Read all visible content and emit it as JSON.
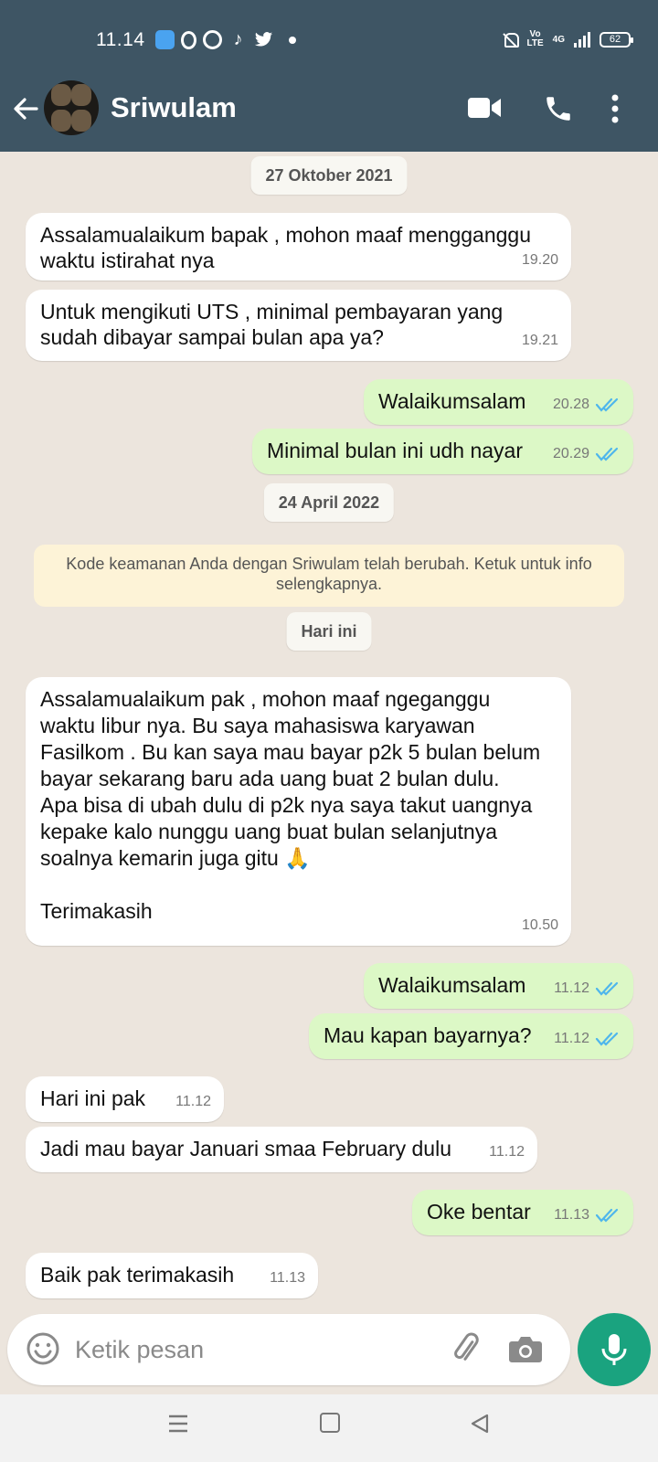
{
  "status_bar": {
    "time": "11.14",
    "battery": "62",
    "network": "4G",
    "volte_top": "Vo",
    "volte_bottom": "LTE"
  },
  "header": {
    "contact_name": "Sriwulam",
    "color": "#3E5564"
  },
  "chat": {
    "dates": [
      "27 Oktober 2021",
      "24 April 2022",
      "Hari ini"
    ],
    "security_notice": "Kode keamanan Anda dengan Sriwulam telah berubah. Ketuk untuk info selengkapnya.",
    "messages": [
      {
        "dir": "in",
        "text": "Assalamualaikum bapak , mohon maaf mengganggu\nwaktu istirahat nya",
        "time": "19.20"
      },
      {
        "dir": "in",
        "text": "Untuk mengikuti UTS , minimal pembayaran yang\nsudah dibayar sampai bulan apa ya?",
        "time": "19.21"
      },
      {
        "dir": "out",
        "text": "Walaikumsalam",
        "time": "20.28"
      },
      {
        "dir": "out",
        "text": "Minimal bulan ini udh nayar",
        "time": "20.29"
      },
      {
        "dir": "in",
        "text": "Assalamualaikum pak , mohon maaf ngeganggu\nwaktu libur nya. Bu saya mahasiswa karyawan\nFasilkom . Bu kan saya mau bayar p2k 5 bulan belum\nbayar sekarang baru ada uang buat 2 bulan dulu.\nApa bisa di ubah dulu di p2k nya saya takut uangnya\nkepake kalo nunggu uang buat bulan selanjutnya\nsoalnya kemarin juga gitu 🙏\n\nTerimakasih",
        "time": "10.50"
      },
      {
        "dir": "out",
        "text": "Walaikumsalam",
        "time": "11.12"
      },
      {
        "dir": "out",
        "text": "Mau kapan bayarnya?",
        "time": "11.12"
      },
      {
        "dir": "in",
        "text": "Hari ini pak",
        "time": "11.12"
      },
      {
        "dir": "in",
        "text": "Jadi mau bayar Januari smaa February dulu",
        "time": "11.12"
      },
      {
        "dir": "out",
        "text": "Oke bentar",
        "time": "11.13"
      },
      {
        "dir": "in",
        "text": "Baik pak terimakasih",
        "time": "11.13"
      }
    ],
    "tick_color": "#4FB6EC",
    "accent": "#1AA37F"
  },
  "composer": {
    "placeholder": "Ketik pesan"
  }
}
